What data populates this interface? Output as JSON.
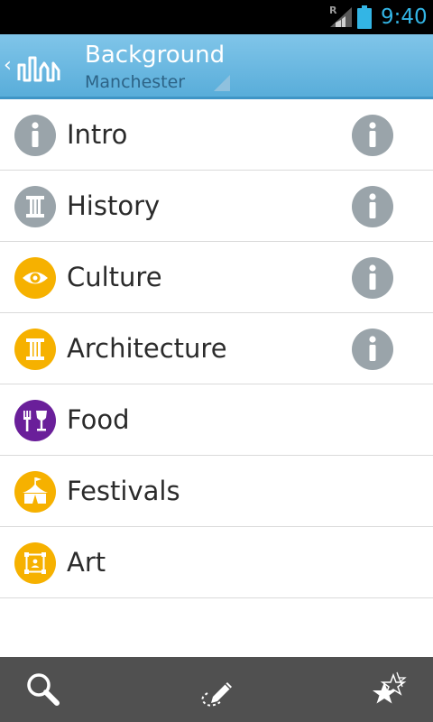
{
  "status_bar": {
    "roaming_indicator": "R",
    "time": "9:40",
    "signal_icon": "signal-icon",
    "battery_icon": "battery-icon",
    "clock_color": "#33b5e5"
  },
  "action_bar": {
    "title": "Background",
    "subtitle": "Manchester",
    "up_icon": "chevron-left-icon",
    "logo_icon": "skyline-logo-icon",
    "colors": {
      "gradient_top": "#80c5e9",
      "gradient_bottom": "#57acd9",
      "subtitle": "#2d6386"
    }
  },
  "list": {
    "items": [
      {
        "label": "Intro",
        "icon": "info-icon",
        "icon_color": "#9aa4aa",
        "has_info": true
      },
      {
        "label": "History",
        "icon": "column-icon",
        "icon_color": "#9aa4aa",
        "has_info": true
      },
      {
        "label": "Culture",
        "icon": "eye-icon",
        "icon_color": "#f6b100",
        "has_info": true
      },
      {
        "label": "Architecture",
        "icon": "column-icon",
        "icon_color": "#f6b100",
        "has_info": true
      },
      {
        "label": "Food",
        "icon": "fork-wine-icon",
        "icon_color": "#6a1f9a",
        "has_info": false
      },
      {
        "label": "Festivals",
        "icon": "tent-icon",
        "icon_color": "#f6b100",
        "has_info": false
      },
      {
        "label": "Art",
        "icon": "picture-frame-icon",
        "icon_color": "#f6b100",
        "has_info": false
      }
    ]
  },
  "bottom_bar": {
    "buttons": [
      "search-icon",
      "route-pencil-icon",
      "stars-icon"
    ],
    "background": "#505050"
  }
}
